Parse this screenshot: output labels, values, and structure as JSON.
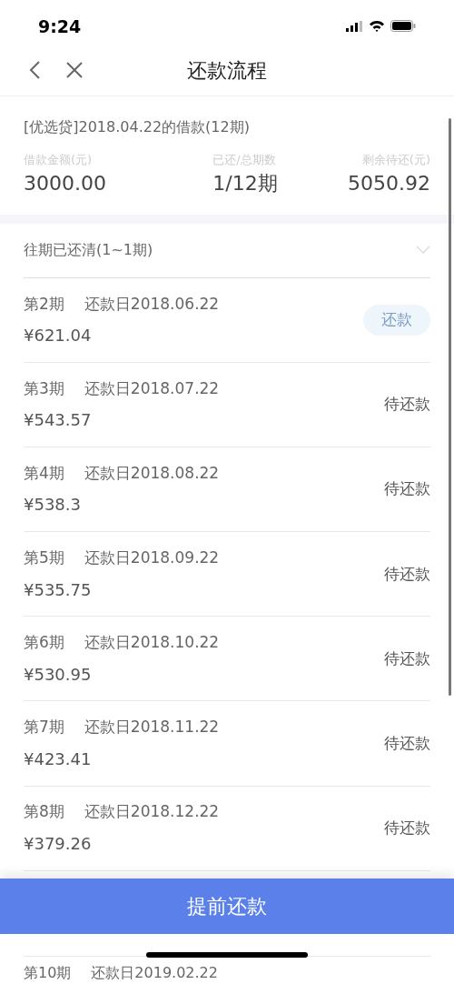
{
  "status_bar": {
    "time": "9:24"
  },
  "nav": {
    "title": "还款流程"
  },
  "summary": {
    "title": "[优选贷]2018.04.22的借款(12期)",
    "stats": [
      {
        "label": "借款金额(元)",
        "value": "3000.00"
      },
      {
        "label": "已还/总期数",
        "value": "1/12期"
      },
      {
        "label": "剩余待还(元)",
        "value": "5050.92"
      }
    ]
  },
  "paid_section": {
    "label": "往期已还清(1~1期)",
    "expanded": false
  },
  "installments": [
    {
      "period": "第2期",
      "due": "还款日2018.06.22",
      "amount": "¥621.04",
      "kind": "button",
      "status": "还款"
    },
    {
      "period": "第3期",
      "due": "还款日2018.07.22",
      "amount": "¥543.57",
      "kind": "pending",
      "status": "待还款"
    },
    {
      "period": "第4期",
      "due": "还款日2018.08.22",
      "amount": "¥538.3",
      "kind": "pending",
      "status": "待还款"
    },
    {
      "period": "第5期",
      "due": "还款日2018.09.22",
      "amount": "¥535.75",
      "kind": "pending",
      "status": "待还款"
    },
    {
      "period": "第6期",
      "due": "还款日2018.10.22",
      "amount": "¥530.95",
      "kind": "pending",
      "status": "待还款"
    },
    {
      "period": "第7期",
      "due": "还款日2018.11.22",
      "amount": "¥423.41",
      "kind": "pending",
      "status": "待还款"
    },
    {
      "period": "第8期",
      "due": "还款日2018.12.22",
      "amount": "¥379.26",
      "kind": "pending",
      "status": "待还款"
    }
  ],
  "prepay_button": "提前还款",
  "next_row": {
    "period": "第10期",
    "due": "还款日2019.02.22"
  }
}
